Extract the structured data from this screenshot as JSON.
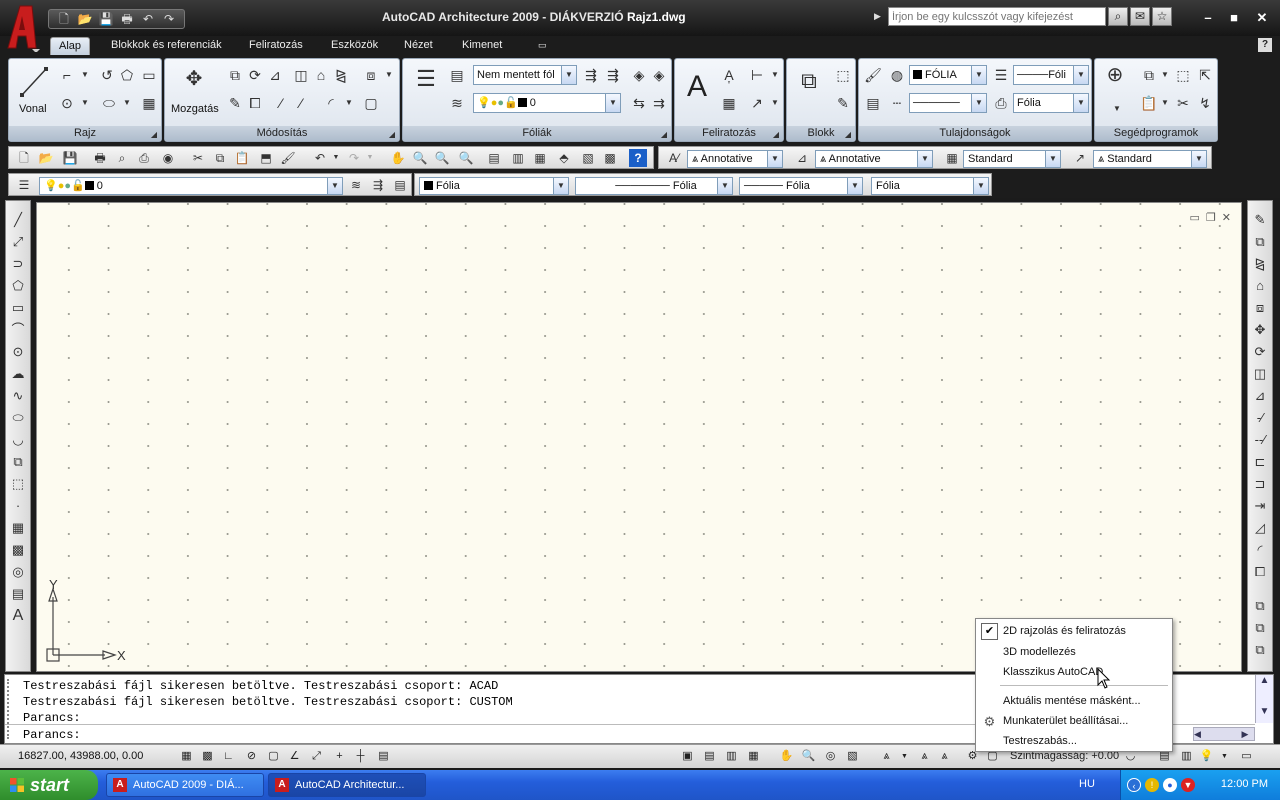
{
  "titlebar": {
    "app": "AutoCAD Architecture 2009 - DIÁKVERZIÓ",
    "document": "Rajz1.dwg",
    "search_placeholder": "Írjon be egy kulcsszót vagy kifejezést"
  },
  "ribbon_tabs": [
    {
      "label": "Alap",
      "active": true
    },
    {
      "label": "Blokkok és referenciák"
    },
    {
      "label": "Feliratozás"
    },
    {
      "label": "Eszközök"
    },
    {
      "label": "Nézet"
    },
    {
      "label": "Kimenet"
    }
  ],
  "ribbon_panels": {
    "draw": {
      "label": "Rajz",
      "line_label": "Vonal"
    },
    "modify": {
      "label": "Módosítás",
      "move_label": "Mozgatás"
    },
    "layers": {
      "label": "Fóliák",
      "layer_state": "Nem mentett fól",
      "current_layer": "0"
    },
    "annotation": {
      "label": "Feliratozás"
    },
    "block": {
      "label": "Blokk"
    },
    "properties": {
      "label": "Tulajdonságok",
      "color": "FÓLIA",
      "linetype": "Fóli",
      "lineweight": "Fólia"
    },
    "utilities": {
      "label": "Segédprogramok"
    }
  },
  "toolbar_styles": {
    "text_style": "Annotative",
    "dim_style": "Annotative",
    "table_style": "Standard",
    "multileader_style": "Standard"
  },
  "toolbar_layers": {
    "current_layer": "0",
    "color": "Fólia",
    "linetype": "Fólia",
    "lineweight": "Fólia",
    "plotstyle": "Fólia"
  },
  "ucs": {
    "x_label": "X",
    "y_label": "Y"
  },
  "command_line": {
    "lines": [
      "Testreszabási fájl sikeresen betöltve. Testreszabási csoport: ACAD",
      "Testreszabási fájl sikeresen betöltve. Testreszabási csoport: CUSTOM",
      "Parancs:"
    ],
    "prompt": "Parancs:"
  },
  "statusbar": {
    "coords": "16827.00, 43988.00, 0.00",
    "elevation": "Szintmagasság: +0.00"
  },
  "context_menu": {
    "items": [
      {
        "label": "2D rajzolás és feliratozás",
        "checked": true
      },
      {
        "label": "3D modellezés"
      },
      {
        "label": "Klasszikus AutoCAD"
      },
      {
        "label": "Aktuális mentése másként..."
      },
      {
        "label": "Munkaterület beállításai..."
      },
      {
        "label": "Testreszabás..."
      }
    ]
  },
  "taskbar": {
    "start": "start",
    "tasks": [
      {
        "label": "AutoCAD 2009 - DIÁ..."
      },
      {
        "label": "AutoCAD Architectur...",
        "active": true
      }
    ],
    "lang": "HU",
    "clock": "12:00 PM"
  },
  "colors": {
    "accent_red": "#c81d1d",
    "ribbon_bg": "#1c1c1c",
    "canvas_bg": "#fdfbf0",
    "taskbar_blue": "#245edb",
    "start_green": "#3a9e38"
  }
}
